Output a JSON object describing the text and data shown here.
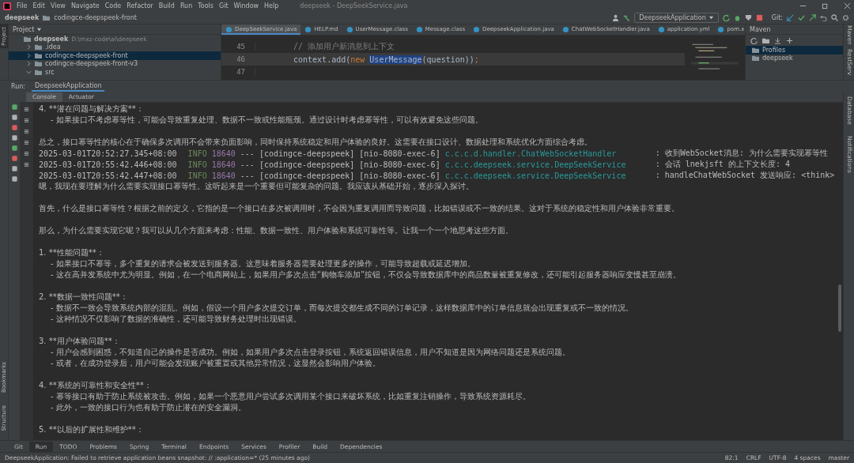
{
  "window": {
    "title": "deepseek - DeepSeekService.java"
  },
  "menu": [
    "File",
    "Edit",
    "View",
    "Navigate",
    "Code",
    "Refactor",
    "Build",
    "Run",
    "Tools",
    "Git",
    "Window",
    "Help"
  ],
  "breadcrumb": [
    "deepseek",
    "codingce-deepspeek-front"
  ],
  "toolbar": {
    "run_config": "DeepseekApplication",
    "git_label": "Git:"
  },
  "left_strip": {
    "top": "Project",
    "bottom": [
      "Bookmarks",
      "Structure"
    ]
  },
  "project": {
    "title": "Project",
    "tree": [
      {
        "name": "deepseek",
        "path": "D:\\mxz-code\\ai\\deepseek",
        "expanded": true,
        "selected": false,
        "children": [
          {
            "name": ".idea",
            "expanded": false,
            "selected": false
          },
          {
            "name": "codingce-deepspeek-front",
            "expanded": false,
            "selected": true
          },
          {
            "name": "codingce-deepspeek-front-v3",
            "expanded": false,
            "selected": false
          },
          {
            "name": "src",
            "expanded": true,
            "selected": false
          }
        ]
      }
    ]
  },
  "editor": {
    "tabs": [
      {
        "label": "DeepSeekService.java",
        "selected": true
      },
      {
        "label": "HELP.md",
        "selected": false
      },
      {
        "label": "UserMessage.class",
        "selected": false
      },
      {
        "label": "Message.class",
        "selected": false
      },
      {
        "label": "DeepseekApplication.java",
        "selected": false
      },
      {
        "label": "ChatWebSocketHandler.java",
        "selected": false
      },
      {
        "label": "application.yml",
        "selected": false
      },
      {
        "label": "pom.x",
        "selected": false
      }
    ],
    "lines": [
      {
        "number": "45",
        "current": false,
        "tokens": [
          {
            "kind": "comment",
            "text": "// 添加用户新消息到上下文"
          }
        ]
      },
      {
        "number": "46",
        "current": true,
        "tokens": [
          {
            "kind": "plain",
            "text": "context.add("
          },
          {
            "kind": "keyword",
            "text": "new "
          },
          {
            "kind": "selected",
            "text": "UserMessage"
          },
          {
            "kind": "plain",
            "text": "(question))"
          },
          {
            "kind": "keyword",
            "text": ";"
          }
        ]
      },
      {
        "number": "47",
        "current": false
      }
    ]
  },
  "maven": {
    "title": "Maven",
    "items": [
      {
        "name": "Profiles",
        "selected": true
      },
      {
        "name": "deepseek",
        "selected": false
      }
    ]
  },
  "right_strip": {
    "top": [
      "Maven",
      "RestServ"
    ],
    "bottom": [
      "Database",
      "Notifications"
    ]
  },
  "run": {
    "label": "Run:",
    "tab": "DeepseekApplication",
    "tabs": [
      {
        "label": "Console",
        "selected": true
      },
      {
        "label": "Actuator",
        "selected": false
      }
    ],
    "lines": [
      {
        "kind": "text",
        "text": "4. **潜在问题与解决方案**："
      },
      {
        "kind": "item",
        "text": "- 如果接口不考虑幂等性，可能会导致重复处理、数据不一致或性能瓶颈。通过设计时考虑幂等性，可以有效避免这些问题。"
      },
      {
        "kind": "blank"
      },
      {
        "kind": "text",
        "text": "总之，接口幂等性的核心在于确保多次调用不会带来负面影响，同时保持系统稳定和用户体验的良好。这需要在接口设计、数据处理和系统优化方面综合考虑。"
      },
      {
        "kind": "log",
        "time": "2025-03-01T20:52:27.345+08:00",
        "level": "INFO",
        "pid": "18640",
        "sep": "---",
        "app": "[codingce-deepspeek]",
        "thread": "[nio-8080-exec-6]",
        "logger": "c.c.c.d.handler.ChatWebSocketHandler",
        "message": ": 收到WebSocket消息: 为什么需要实现幂等性"
      },
      {
        "kind": "log",
        "time": "2025-03-01T20:55:42.446+08:00",
        "level": "INFO",
        "pid": "18640",
        "sep": "---",
        "app": "[codingce-deepspeek]",
        "thread": "[nio-8080-exec-6]",
        "logger": "c.c.c.deepseek.service.DeepSeekService",
        "message": ": 会话 lnekjsft 的上下文长度: 4"
      },
      {
        "kind": "log",
        "time": "2025-03-01T20:55:42.447+08:00",
        "level": "INFO",
        "pid": "18640",
        "sep": "---",
        "app": "[codingce-deepspeek]",
        "thread": "[nio-8080-exec-6]",
        "logger": "c.c.c.deepseek.service.DeepSeekService",
        "message": ": handleChatWebSocket 发送响应: <think>"
      },
      {
        "kind": "text",
        "text": "嗯，我现在要理解为什么需要实现接口幂等性。这听起来是一个重要但可能复杂的问题。我应该从基础开始，逐步深入探讨。"
      },
      {
        "kind": "blank"
      },
      {
        "kind": "text",
        "text": "首先，什么是接口幂等性？根据之前的定义，它指的是一个接口在多次被调用时，不会因为重复调用而导致问题，比如错误或不一致的结果。这对于系统的稳定性和用户体验非常重要。"
      },
      {
        "kind": "blank"
      },
      {
        "kind": "text",
        "text": "那么，为什么需要实现它呢？我可以从几个方面来考虑：性能、数据一致性、用户体验和系统可靠性等。让我一个一个地思考这些方面。"
      },
      {
        "kind": "blank"
      },
      {
        "kind": "text",
        "text": "1. **性能问题**："
      },
      {
        "kind": "item",
        "text": "- 如果接口不幂等，多个重复的请求会被发送到服务器。这意味着服务器需要处理更多的操作，可能导致超载或延迟增加。"
      },
      {
        "kind": "item",
        "text": "- 这在高并发系统中尤为明显。例如，在一个电商网站上，如果用户多次点击“购物车添加”按钮，不仅会导致数据库中的商品数量被重复修改，还可能引起服务器响应变慢甚至崩溃。"
      },
      {
        "kind": "blank"
      },
      {
        "kind": "text",
        "text": "2. **数据一致性问题**："
      },
      {
        "kind": "item",
        "text": "- 数据不一致会导致系统内部的混乱。例如，假设一个用户多次提交订单，而每次提交都生成不同的订单记录，这样数据库中的订单信息就会出现重复或不一致的情况。"
      },
      {
        "kind": "item",
        "text": "- 这种情况不仅影响了数据的准确性，还可能导致财务处理时出现错误。"
      },
      {
        "kind": "blank"
      },
      {
        "kind": "text",
        "text": "3. **用户体验问题**："
      },
      {
        "kind": "item",
        "text": "- 用户会感到困惑，不知道自己的操作是否成功。例如，如果用户多次点击登录按钮，系统返回错误信息，用户不知道是因为网络问题还是系统问题。"
      },
      {
        "kind": "item",
        "text": "- 或者，在成功登录后，用户可能会发现账户被重置或其他异常情况，这显然会影响用户体验。"
      },
      {
        "kind": "blank"
      },
      {
        "kind": "text",
        "text": "4. **系统的可靠性和安全性**："
      },
      {
        "kind": "item",
        "text": "- 幂等接口有助于防止系统被攻击。例如，如果一个恶意用户尝试多次调用某个接口来破坏系统，比如重复注销操作，导致系统资源耗尽。"
      },
      {
        "kind": "item",
        "text": "- 此外，一致的接口行为也有助于防止潜在的安全漏洞。"
      },
      {
        "kind": "blank"
      },
      {
        "kind": "text",
        "text": "5. **以后的扩展性和维护**："
      }
    ]
  },
  "tool_tabs": [
    {
      "label": "Git",
      "selected": false
    },
    {
      "label": "Run",
      "selected": true
    },
    {
      "label": "TODO",
      "selected": false
    },
    {
      "label": "Problems",
      "selected": false
    },
    {
      "label": "Spring",
      "selected": false
    },
    {
      "label": "Terminal",
      "selected": false
    },
    {
      "label": "Endpoints",
      "selected": false
    },
    {
      "label": "Services",
      "selected": false
    },
    {
      "label": "Profiler",
      "selected": false
    },
    {
      "label": "Build",
      "selected": false
    },
    {
      "label": "Dependencies",
      "selected": false
    }
  ],
  "status_bar": {
    "message": "DeepseekApplication: Failed to retrieve application beans snapshot: // :application=* (25 minutes ago)",
    "items": [
      "82:1",
      "CRLF",
      "UTF-8",
      "4 spaces",
      "master"
    ]
  }
}
